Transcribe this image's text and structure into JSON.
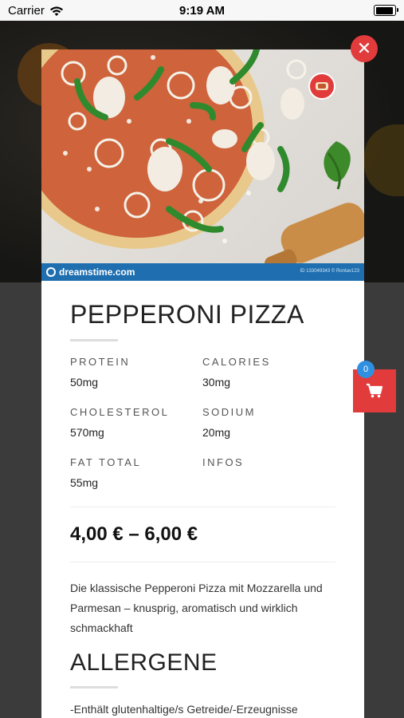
{
  "status_bar": {
    "carrier": "Carrier",
    "time": "9:19 AM"
  },
  "photo": {
    "watermark_brand": "dreamstime.com",
    "watermark_id": "ID 133049343 © Rontav123"
  },
  "product": {
    "title": "PEPPERONI PIZZA",
    "nutrition": [
      {
        "label": "PROTEIN",
        "value": "50mg"
      },
      {
        "label": "CALORIES",
        "value": "30mg"
      },
      {
        "label": "CHOLESTEROL",
        "value": "570mg"
      },
      {
        "label": "SODIUM",
        "value": "20mg"
      },
      {
        "label": "FAT TOTAL",
        "value": "55mg"
      },
      {
        "label": "INFOS",
        "value": ""
      }
    ],
    "price": "4,00 € – 6,00 €",
    "description": "Die klassische Pepperoni Pizza mit Mozzarella und Parmesan – knusprig, aromatisch und wirklich schmackhaft",
    "allergen_title": "ALLERGENE",
    "allergens": [
      "-Enthält glutenhaltige/s Getreide/-Erzeugnisse"
    ]
  },
  "cart": {
    "count": "0"
  },
  "icons": {
    "wifi": "wifi-icon",
    "battery": "battery-icon",
    "close": "close-icon",
    "cart": "shopping-cart-icon"
  },
  "colors": {
    "accent": "#e23b3b",
    "badge": "#2f8fe0",
    "watermark": "#1f6fb0"
  }
}
